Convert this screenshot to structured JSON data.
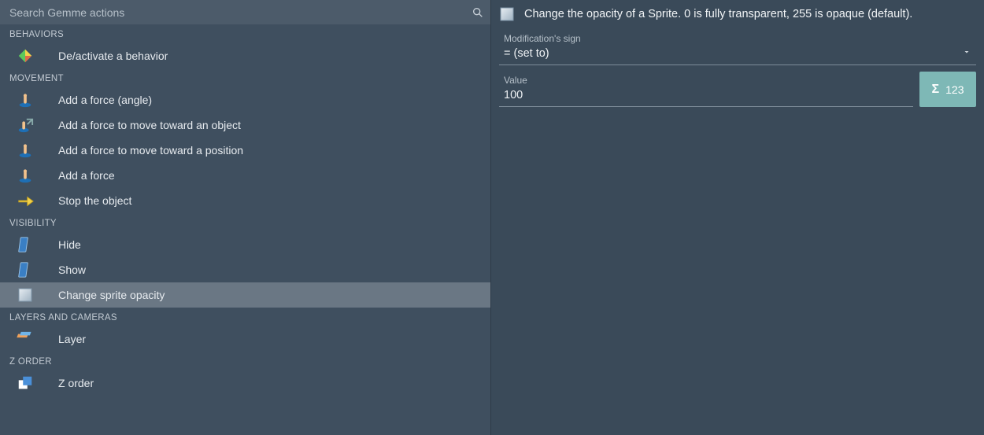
{
  "search": {
    "placeholder": "Search Gemme actions",
    "value": ""
  },
  "categories": [
    {
      "name": "BEHAVIORS",
      "items": [
        {
          "label": "De/activate a behavior",
          "icon": "behavior-diamond"
        }
      ]
    },
    {
      "name": "MOVEMENT",
      "items": [
        {
          "label": "Add a force (angle)",
          "icon": "finger-force"
        },
        {
          "label": "Add a force to move toward an object",
          "icon": "finger-arrow-diag"
        },
        {
          "label": "Add a force to move toward a position",
          "icon": "finger-force"
        },
        {
          "label": "Add a force",
          "icon": "finger-force"
        },
        {
          "label": "Stop the object",
          "icon": "stop-arrow"
        }
      ]
    },
    {
      "name": "VISIBILITY",
      "items": [
        {
          "label": "Hide",
          "icon": "panel-blue"
        },
        {
          "label": "Show",
          "icon": "panel-blue"
        },
        {
          "label": "Change sprite opacity",
          "icon": "opacity-square",
          "selected": true
        }
      ]
    },
    {
      "name": "LAYERS AND CAMERAS",
      "items": [
        {
          "label": "Layer",
          "icon": "layers"
        }
      ]
    },
    {
      "name": "Z ORDER",
      "items": [
        {
          "label": "Z order",
          "icon": "zorder"
        }
      ]
    }
  ],
  "detail": {
    "icon": "opacity-square",
    "description": "Change the opacity of a Sprite. 0 is fully transparent, 255 is opaque (default).",
    "modLabel": "Modification's sign",
    "modValue": "= (set to)",
    "valueLabel": "Value",
    "valueValue": "100",
    "sigmaLabel": "123"
  }
}
